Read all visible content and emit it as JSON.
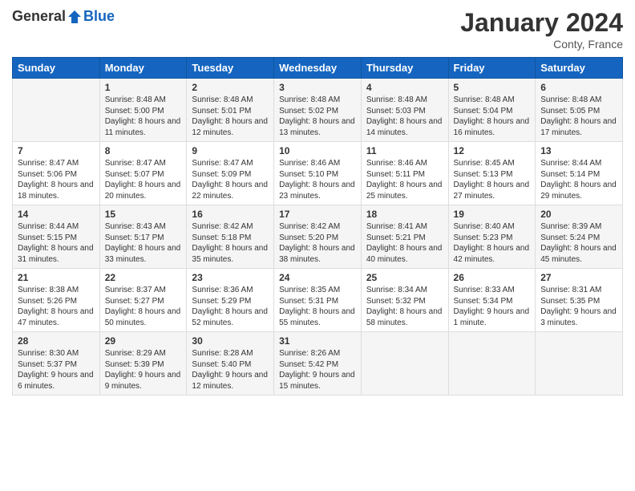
{
  "header": {
    "logo_general": "General",
    "logo_blue": "Blue",
    "month_title": "January 2024",
    "location": "Conty, France"
  },
  "columns": [
    "Sunday",
    "Monday",
    "Tuesday",
    "Wednesday",
    "Thursday",
    "Friday",
    "Saturday"
  ],
  "weeks": [
    [
      {
        "day": "",
        "sunrise": "",
        "sunset": "",
        "daylight": ""
      },
      {
        "day": "1",
        "sunrise": "Sunrise: 8:48 AM",
        "sunset": "Sunset: 5:00 PM",
        "daylight": "Daylight: 8 hours and 11 minutes."
      },
      {
        "day": "2",
        "sunrise": "Sunrise: 8:48 AM",
        "sunset": "Sunset: 5:01 PM",
        "daylight": "Daylight: 8 hours and 12 minutes."
      },
      {
        "day": "3",
        "sunrise": "Sunrise: 8:48 AM",
        "sunset": "Sunset: 5:02 PM",
        "daylight": "Daylight: 8 hours and 13 minutes."
      },
      {
        "day": "4",
        "sunrise": "Sunrise: 8:48 AM",
        "sunset": "Sunset: 5:03 PM",
        "daylight": "Daylight: 8 hours and 14 minutes."
      },
      {
        "day": "5",
        "sunrise": "Sunrise: 8:48 AM",
        "sunset": "Sunset: 5:04 PM",
        "daylight": "Daylight: 8 hours and 16 minutes."
      },
      {
        "day": "6",
        "sunrise": "Sunrise: 8:48 AM",
        "sunset": "Sunset: 5:05 PM",
        "daylight": "Daylight: 8 hours and 17 minutes."
      }
    ],
    [
      {
        "day": "7",
        "sunrise": "Sunrise: 8:47 AM",
        "sunset": "Sunset: 5:06 PM",
        "daylight": "Daylight: 8 hours and 18 minutes."
      },
      {
        "day": "8",
        "sunrise": "Sunrise: 8:47 AM",
        "sunset": "Sunset: 5:07 PM",
        "daylight": "Daylight: 8 hours and 20 minutes."
      },
      {
        "day": "9",
        "sunrise": "Sunrise: 8:47 AM",
        "sunset": "Sunset: 5:09 PM",
        "daylight": "Daylight: 8 hours and 22 minutes."
      },
      {
        "day": "10",
        "sunrise": "Sunrise: 8:46 AM",
        "sunset": "Sunset: 5:10 PM",
        "daylight": "Daylight: 8 hours and 23 minutes."
      },
      {
        "day": "11",
        "sunrise": "Sunrise: 8:46 AM",
        "sunset": "Sunset: 5:11 PM",
        "daylight": "Daylight: 8 hours and 25 minutes."
      },
      {
        "day": "12",
        "sunrise": "Sunrise: 8:45 AM",
        "sunset": "Sunset: 5:13 PM",
        "daylight": "Daylight: 8 hours and 27 minutes."
      },
      {
        "day": "13",
        "sunrise": "Sunrise: 8:44 AM",
        "sunset": "Sunset: 5:14 PM",
        "daylight": "Daylight: 8 hours and 29 minutes."
      }
    ],
    [
      {
        "day": "14",
        "sunrise": "Sunrise: 8:44 AM",
        "sunset": "Sunset: 5:15 PM",
        "daylight": "Daylight: 8 hours and 31 minutes."
      },
      {
        "day": "15",
        "sunrise": "Sunrise: 8:43 AM",
        "sunset": "Sunset: 5:17 PM",
        "daylight": "Daylight: 8 hours and 33 minutes."
      },
      {
        "day": "16",
        "sunrise": "Sunrise: 8:42 AM",
        "sunset": "Sunset: 5:18 PM",
        "daylight": "Daylight: 8 hours and 35 minutes."
      },
      {
        "day": "17",
        "sunrise": "Sunrise: 8:42 AM",
        "sunset": "Sunset: 5:20 PM",
        "daylight": "Daylight: 8 hours and 38 minutes."
      },
      {
        "day": "18",
        "sunrise": "Sunrise: 8:41 AM",
        "sunset": "Sunset: 5:21 PM",
        "daylight": "Daylight: 8 hours and 40 minutes."
      },
      {
        "day": "19",
        "sunrise": "Sunrise: 8:40 AM",
        "sunset": "Sunset: 5:23 PM",
        "daylight": "Daylight: 8 hours and 42 minutes."
      },
      {
        "day": "20",
        "sunrise": "Sunrise: 8:39 AM",
        "sunset": "Sunset: 5:24 PM",
        "daylight": "Daylight: 8 hours and 45 minutes."
      }
    ],
    [
      {
        "day": "21",
        "sunrise": "Sunrise: 8:38 AM",
        "sunset": "Sunset: 5:26 PM",
        "daylight": "Daylight: 8 hours and 47 minutes."
      },
      {
        "day": "22",
        "sunrise": "Sunrise: 8:37 AM",
        "sunset": "Sunset: 5:27 PM",
        "daylight": "Daylight: 8 hours and 50 minutes."
      },
      {
        "day": "23",
        "sunrise": "Sunrise: 8:36 AM",
        "sunset": "Sunset: 5:29 PM",
        "daylight": "Daylight: 8 hours and 52 minutes."
      },
      {
        "day": "24",
        "sunrise": "Sunrise: 8:35 AM",
        "sunset": "Sunset: 5:31 PM",
        "daylight": "Daylight: 8 hours and 55 minutes."
      },
      {
        "day": "25",
        "sunrise": "Sunrise: 8:34 AM",
        "sunset": "Sunset: 5:32 PM",
        "daylight": "Daylight: 8 hours and 58 minutes."
      },
      {
        "day": "26",
        "sunrise": "Sunrise: 8:33 AM",
        "sunset": "Sunset: 5:34 PM",
        "daylight": "Daylight: 9 hours and 1 minute."
      },
      {
        "day": "27",
        "sunrise": "Sunrise: 8:31 AM",
        "sunset": "Sunset: 5:35 PM",
        "daylight": "Daylight: 9 hours and 3 minutes."
      }
    ],
    [
      {
        "day": "28",
        "sunrise": "Sunrise: 8:30 AM",
        "sunset": "Sunset: 5:37 PM",
        "daylight": "Daylight: 9 hours and 6 minutes."
      },
      {
        "day": "29",
        "sunrise": "Sunrise: 8:29 AM",
        "sunset": "Sunset: 5:39 PM",
        "daylight": "Daylight: 9 hours and 9 minutes."
      },
      {
        "day": "30",
        "sunrise": "Sunrise: 8:28 AM",
        "sunset": "Sunset: 5:40 PM",
        "daylight": "Daylight: 9 hours and 12 minutes."
      },
      {
        "day": "31",
        "sunrise": "Sunrise: 8:26 AM",
        "sunset": "Sunset: 5:42 PM",
        "daylight": "Daylight: 9 hours and 15 minutes."
      },
      {
        "day": "",
        "sunrise": "",
        "sunset": "",
        "daylight": ""
      },
      {
        "day": "",
        "sunrise": "",
        "sunset": "",
        "daylight": ""
      },
      {
        "day": "",
        "sunrise": "",
        "sunset": "",
        "daylight": ""
      }
    ]
  ]
}
